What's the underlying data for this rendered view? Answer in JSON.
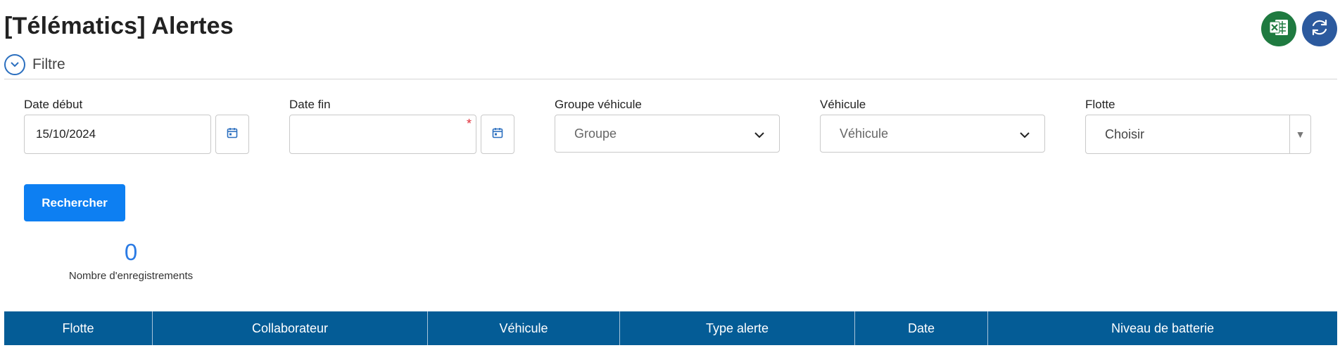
{
  "page": {
    "title": "[Télématics] Alertes"
  },
  "actions": {
    "excel_icon": "excel-icon",
    "refresh_icon": "refresh-icon"
  },
  "filter": {
    "toggle_label": "Filtre",
    "date_debut": {
      "label": "Date début",
      "value": "15/10/2024"
    },
    "date_fin": {
      "label": "Date fin",
      "value": "",
      "required_mark": "*"
    },
    "groupe_vehicule": {
      "label": "Groupe véhicule",
      "selected": "Groupe"
    },
    "vehicule": {
      "label": "Véhicule",
      "selected": "Véhicule"
    },
    "flotte": {
      "label": "Flotte",
      "selected": "Choisir"
    },
    "search_button": "Rechercher"
  },
  "stats": {
    "count": "0",
    "count_label": "Nombre d'enregistrements"
  },
  "table": {
    "columns": [
      "Flotte",
      "Collaborateur",
      "Véhicule",
      "Type alerte",
      "Date",
      "Niveau de batterie"
    ]
  },
  "colors": {
    "header_bg": "#045c96",
    "primary_button": "#0d7ff2",
    "count_text": "#2b7be4",
    "excel_green": "#1f7a40",
    "refresh_blue": "#2c5a9e",
    "required_red": "#e0303a"
  }
}
